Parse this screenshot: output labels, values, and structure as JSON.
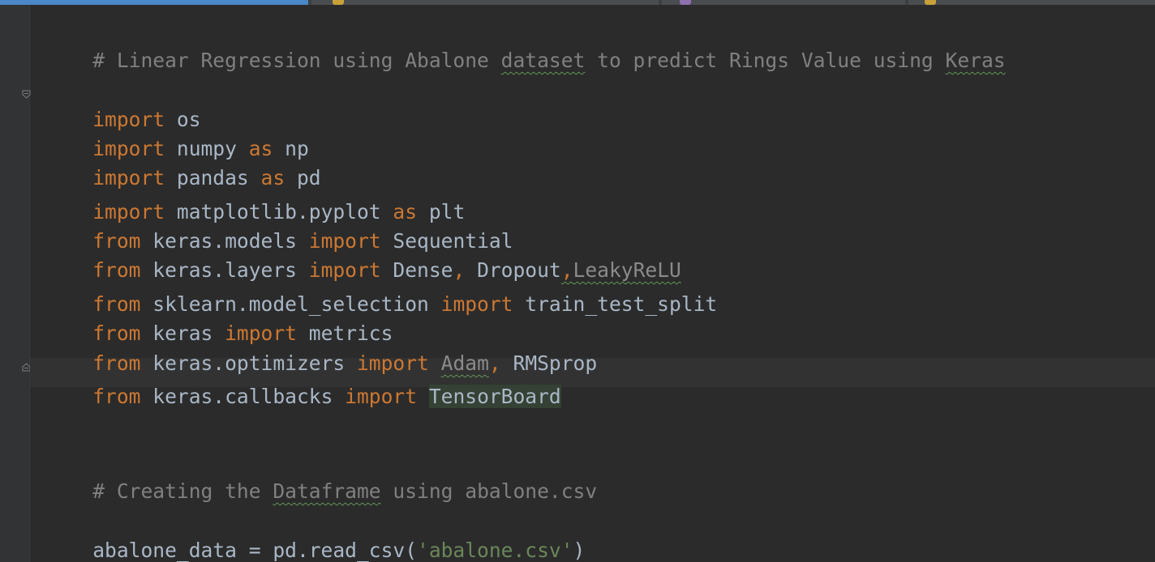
{
  "colors": {
    "background": "#2b2b2b",
    "gutter": "#313335",
    "keyword": "#cc7832",
    "comment": "#808080",
    "string": "#6a8759",
    "text": "#a9b7c6",
    "unresolved": "#8a8a8a",
    "active_tab": "#4a88c7",
    "typo_underline": "#629755"
  },
  "editor": {
    "line_01": {
      "comment_prefix": "# Linear Regression using Abalone ",
      "typo_1": "dataset",
      "comment_mid": " to predict Rings Value using ",
      "typo_2": "Keras"
    },
    "line_03": {
      "kw_import": "import",
      "module": " os"
    },
    "line_04": {
      "kw_import": "import",
      "module": " numpy ",
      "kw_as": "as",
      "alias": " np"
    },
    "line_05": {
      "kw_import": "import",
      "module": " pandas ",
      "kw_as": "as",
      "alias": " pd"
    },
    "line_06": {
      "kw_import": "import",
      "module": " matplotlib.pyplot ",
      "kw_as": "as",
      "alias": " plt"
    },
    "line_07": {
      "kw_from": "from",
      "module": " keras.models ",
      "kw_import": "import",
      "names": " Sequential"
    },
    "line_08": {
      "kw_from": "from",
      "module": " keras.layers ",
      "kw_import": "import",
      "names_a": " Dense",
      "comma_1": ",",
      "names_b": " Dropout",
      "comma_2": ",",
      "names_c": "LeakyReLU"
    },
    "line_09": {
      "kw_from": "from",
      "module": " sklearn.model_selection ",
      "kw_import": "import",
      "names": " train_test_split"
    },
    "line_10": {
      "kw_from": "from",
      "module": " keras ",
      "kw_import": "import",
      "names": " metrics"
    },
    "line_11": {
      "kw_from": "from",
      "module": " keras.optimizers ",
      "kw_import": "import",
      "space": " ",
      "names_a": "Adam",
      "comma": ",",
      "names_b": " RMSprop"
    },
    "line_12": {
      "kw_from": "from",
      "module": " keras.callbacks ",
      "kw_import": "import",
      "space": " ",
      "names": "TensorBoard"
    },
    "line_15": {
      "comment_prefix": "# Creating the ",
      "typo": "Dataframe",
      "comment_suffix": " using abalone.csv"
    },
    "line_17": {
      "target": "abalone_data = pd.read_csv(",
      "string": "'abalone.csv'",
      "close": ")"
    }
  }
}
